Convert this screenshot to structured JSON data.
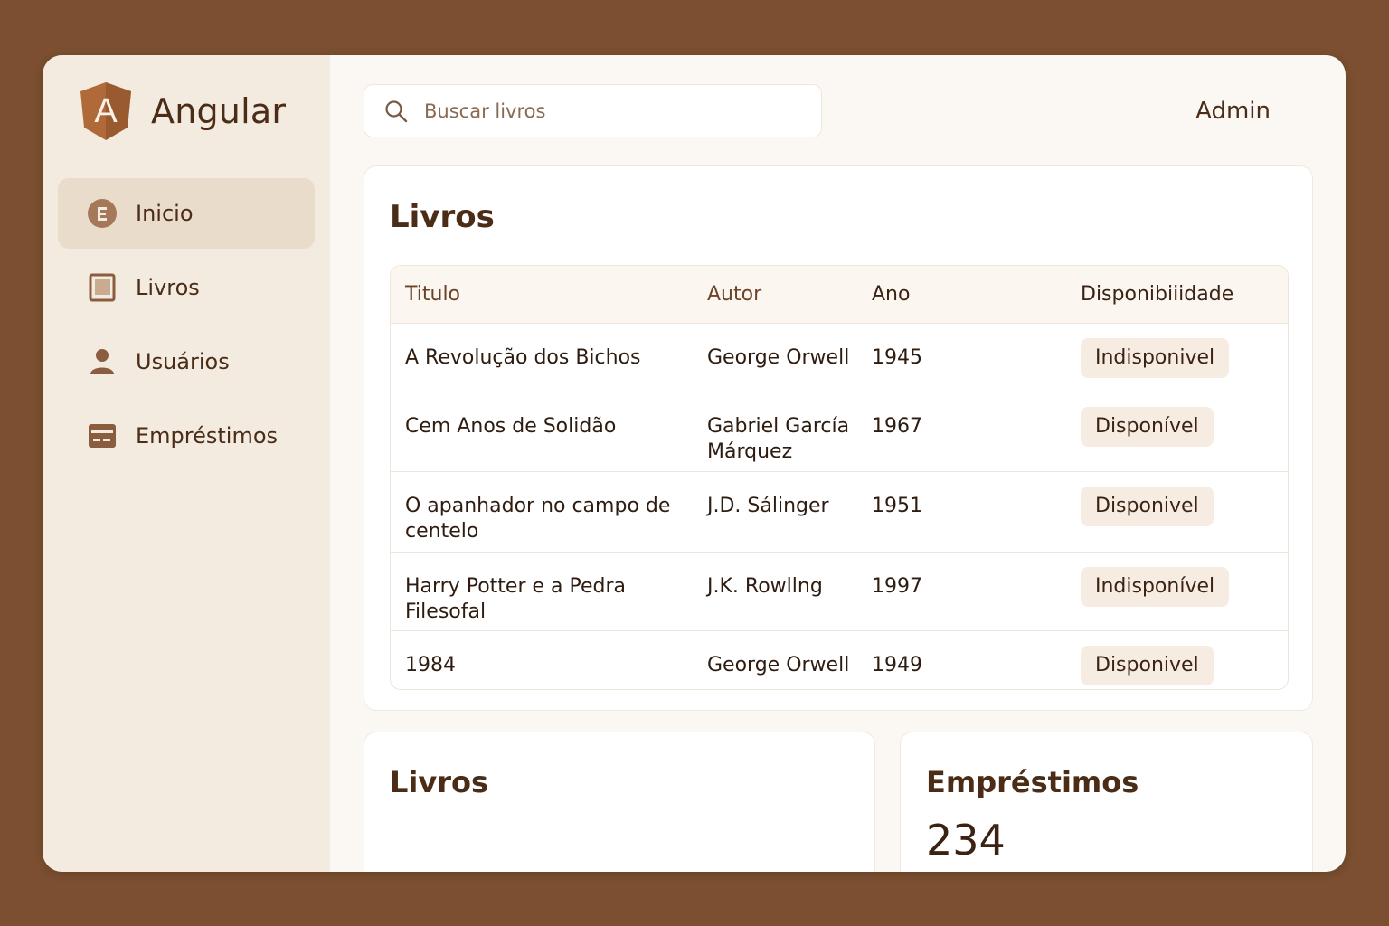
{
  "brand": {
    "name": "Angular",
    "logo_letter": "A",
    "logo_color": "#b06a3a"
  },
  "sidebar": {
    "items": [
      {
        "label": "Inicio",
        "icon": "home-circle-icon",
        "active": true
      },
      {
        "label": "Livros",
        "icon": "book-icon",
        "active": false
      },
      {
        "label": "Usuários",
        "icon": "user-icon",
        "active": false
      },
      {
        "label": "Empréstimos",
        "icon": "card-icon",
        "active": false
      }
    ]
  },
  "header": {
    "search_placeholder": "Buscar livros",
    "user": "Admin"
  },
  "books_table": {
    "title": "Livros",
    "columns": [
      "Titulo",
      "Autor",
      "Ano",
      "Disponibiiidade"
    ],
    "rows": [
      {
        "title": "A Revolução dos Bichos",
        "author": "George Orwell",
        "year": "1945",
        "status": "Indisponivel"
      },
      {
        "title": "Cem Anos de Solidão",
        "author": "Gabriel García Márquez",
        "year": "1967",
        "status": "Disponível"
      },
      {
        "title": "O apanhador no campo de centelo",
        "author": "J.D. Sálinger",
        "year": "1951",
        "status": "Disponivel"
      },
      {
        "title": "Harry Potter e a Pedra Filesofal",
        "author": "J.K. Rowllng",
        "year": "1997",
        "status": "Indisponível"
      },
      {
        "title": "1984",
        "author": "George Orwell",
        "year": "1949",
        "status": "Disponivel"
      }
    ]
  },
  "stats": {
    "books": {
      "title": "Livros"
    },
    "loans": {
      "title": "Empréstimos",
      "value": "234"
    }
  },
  "colors": {
    "background": "#7b4f30",
    "sidebar": "#f4ebe0",
    "active_item": "#e9dccb",
    "text": "#4a2c17",
    "badge": "#f6ece1"
  }
}
